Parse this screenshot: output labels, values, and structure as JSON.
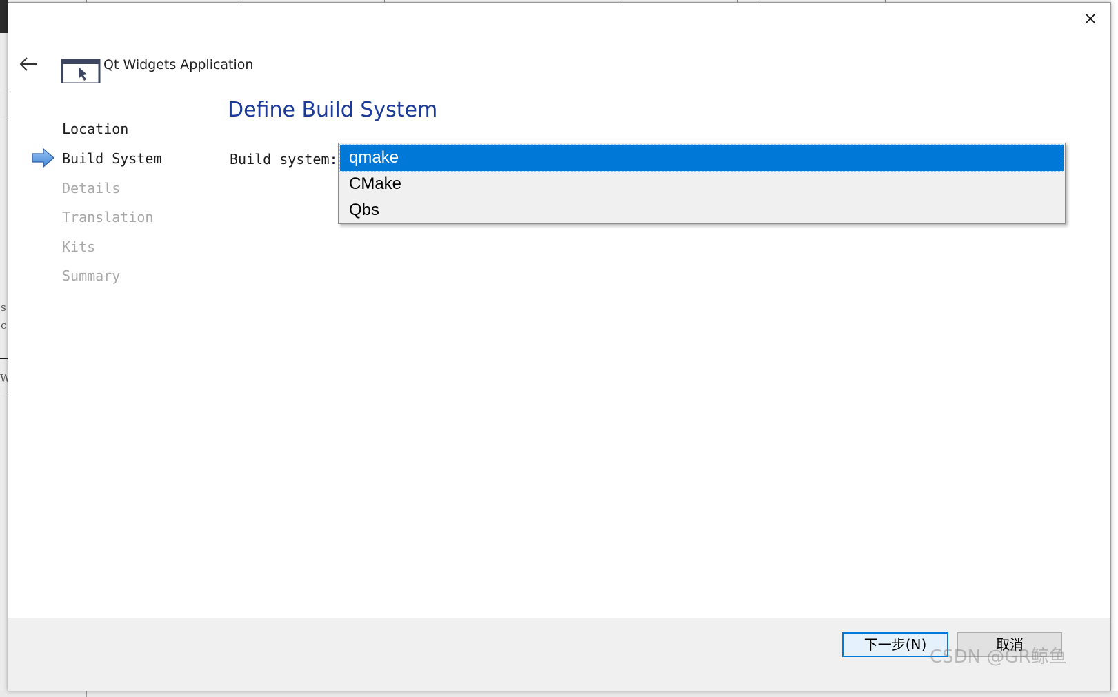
{
  "wizard": {
    "app_title": "Qt Widgets Application",
    "page_title": "Define Build System",
    "steps": [
      {
        "label": "Location",
        "state": "done"
      },
      {
        "label": "Build System",
        "state": "current"
      },
      {
        "label": "Details",
        "state": "todo"
      },
      {
        "label": "Translation",
        "state": "todo"
      },
      {
        "label": "Kits",
        "state": "todo"
      },
      {
        "label": "Summary",
        "state": "todo"
      }
    ],
    "build_system": {
      "label": "Build system:",
      "selected": "qmake",
      "options": [
        "qmake",
        "CMake",
        "Qbs"
      ]
    },
    "buttons": {
      "next_label": "下一步(N)",
      "cancel_label": "取消"
    },
    "icons": {
      "close": "close-icon",
      "back": "back-arrow-icon",
      "app": "app-window-icon",
      "current_step": "current-step-arrow-icon"
    },
    "colors": {
      "accent": "#0078d7",
      "title": "#1b3b9a",
      "todo_step": "#a8a8a8"
    }
  },
  "background": {
    "fragments": [
      "s",
      "c",
      "W"
    ]
  },
  "watermark": "CSDN @GR鲸鱼"
}
